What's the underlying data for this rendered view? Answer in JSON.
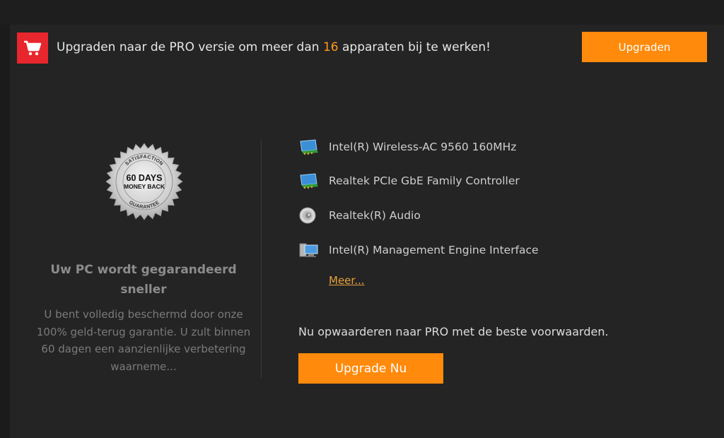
{
  "banner": {
    "text_before": "Upgraden naar de PRO versie om meer dan ",
    "device_count": "16",
    "text_after": " apparaten bij te werken!",
    "upgrade_button": "Upgraden",
    "cart_icon": "shopping-cart-icon"
  },
  "guarantee": {
    "badge": {
      "top": "SATISFACTION",
      "days": "60 DAYS",
      "money": "MONEY BACK",
      "bottom": "GUARANTEE"
    },
    "title": "Uw PC wordt gegarandeerd sneller",
    "body": "U bent volledig beschermd door onze 100% geld-terug garantie. U zult binnen 60 dagen een aanzienlijke verbetering waarneme..."
  },
  "devices": [
    {
      "icon": "network-adapter-icon",
      "label": "Intel(R) Wireless-AC 9560 160MHz"
    },
    {
      "icon": "network-adapter-icon",
      "label": "Realtek PCIe GbE Family Controller"
    },
    {
      "icon": "speaker-icon",
      "label": "Realtek(R) Audio"
    },
    {
      "icon": "computer-icon",
      "label": "Intel(R) Management Engine Interface"
    }
  ],
  "more_link": "Meer...",
  "cta": {
    "text": "Nu opwaarderen naar PRO met de beste voorwaarden.",
    "button": "Upgrade Nu"
  },
  "colors": {
    "accent_orange": "#ff8a0c",
    "cart_red": "#e8262d",
    "link_orange": "#e8a23a"
  }
}
